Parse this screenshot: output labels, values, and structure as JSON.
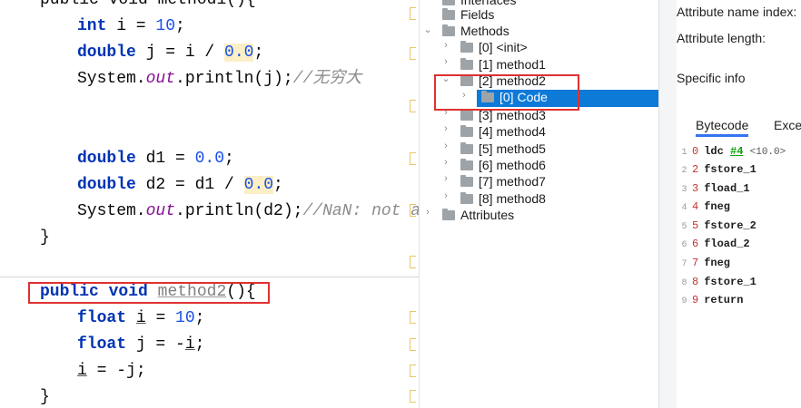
{
  "editor": {
    "line_top": "public void method1(){",
    "line1": {
      "kw": "int",
      "rest": " i = ",
      "num": "10",
      "end": ";"
    },
    "line2": {
      "kw": "double",
      "rest": " j = i / ",
      "num": "0.0",
      "end": ";"
    },
    "line3": {
      "a": "System.",
      "fld": "out",
      "b": ".println(j);",
      "cmt": "//无穷大"
    },
    "line4": {
      "kw": "double",
      "rest": " d1 = ",
      "num": "0.0",
      "end": ";"
    },
    "line5": {
      "kw": "double",
      "rest": " d2 = d1 / ",
      "num": "0.0",
      "end": ";"
    },
    "line6": {
      "a": "System.",
      "fld": "out",
      "b": ".println(d2);",
      "cmt": "//NaN: not a"
    },
    "line7": "}",
    "method2_sig": {
      "kw1": "public",
      "kw2": "void",
      "name": "method2",
      "end": "(){"
    },
    "line8": {
      "kw": "float",
      "var": "i",
      "rest": " = ",
      "num": "10",
      "end": ";"
    },
    "line9": {
      "kw": "float",
      "rest": " j = -",
      "var": "i",
      "end": ";"
    },
    "line10": {
      "var": "i",
      "rest": " = -j;"
    },
    "line11": "}"
  },
  "tree": {
    "interfaces": "Interfaces",
    "fields": "Fields",
    "methods": "Methods",
    "method_items": [
      "[0] <init>",
      "[1] method1",
      "[2] method2",
      "[0] Code",
      "[3] method3",
      "[4] method4",
      "[5] method5",
      "[6] method6",
      "[7] method7",
      "[8] method8"
    ],
    "attributes": "Attributes"
  },
  "info": {
    "attr_name_index": "Attribute name index:",
    "attr_length": "Attribute length:",
    "specific_info": "Specific info",
    "tabs": [
      "Bytecode",
      "Excep"
    ],
    "bytecode": [
      {
        "ln": "1",
        "off": "0",
        "op": "ldc",
        "ref": "#4",
        "cmt": "<10.0>"
      },
      {
        "ln": "2",
        "off": "2",
        "op": "fstore_1"
      },
      {
        "ln": "3",
        "off": "3",
        "op": "fload_1"
      },
      {
        "ln": "4",
        "off": "4",
        "op": "fneg"
      },
      {
        "ln": "5",
        "off": "5",
        "op": "fstore_2"
      },
      {
        "ln": "6",
        "off": "6",
        "op": "fload_2"
      },
      {
        "ln": "7",
        "off": "7",
        "op": "fneg"
      },
      {
        "ln": "8",
        "off": "8",
        "op": "fstore_1"
      },
      {
        "ln": "9",
        "off": "9",
        "op": "return"
      }
    ]
  },
  "colors": {
    "selection": "#0d7ad8",
    "annotation": "#e03030",
    "keyword": "#0033b3",
    "number": "#1750eb"
  }
}
